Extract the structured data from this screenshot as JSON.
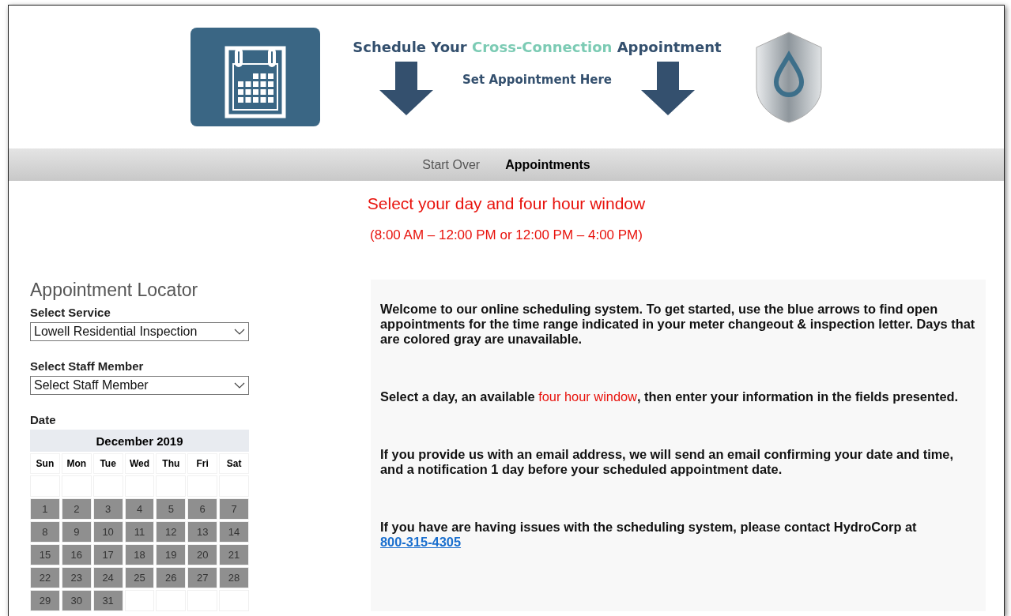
{
  "header": {
    "title": [
      {
        "kind": "plain",
        "text": "Schedule Your "
      },
      {
        "kind": "accent",
        "text": "Cross-Connection"
      },
      {
        "kind": "plain",
        "text": " Appointment"
      }
    ],
    "subtitle": "Set Appointment Here"
  },
  "nav": [
    {
      "label": "Start Over",
      "selected": false
    },
    {
      "label": "Appointments",
      "selected": true
    }
  ],
  "instructions": {
    "heading": "Select your day and four hour window",
    "hours": "(8:00 AM – 12:00 PM or 12:00 PM – 4:00 PM)"
  },
  "locator": {
    "title": "Appointment Locator",
    "service_label": "Select Service",
    "service_value": "Lowell Residential Inspection",
    "staff_label": "Select Staff Member",
    "staff_value": "Select Staff Member",
    "date_label": "Date"
  },
  "calendar": {
    "month": "December 2019",
    "weekdays": [
      "Sun",
      "Mon",
      "Tue",
      "Wed",
      "Thu",
      "Fri",
      "Sat"
    ],
    "weeks": [
      [
        {
          "kind": "blank"
        },
        {
          "kind": "blank"
        },
        {
          "kind": "blank"
        },
        {
          "kind": "blank"
        },
        {
          "kind": "blank"
        },
        {
          "kind": "blank"
        },
        {
          "kind": "blank"
        }
      ],
      [
        {
          "kind": "day",
          "label": "1",
          "disabled": true
        },
        {
          "kind": "day",
          "label": "2",
          "disabled": true
        },
        {
          "kind": "day",
          "label": "3",
          "disabled": true
        },
        {
          "kind": "day",
          "label": "4",
          "disabled": true
        },
        {
          "kind": "day",
          "label": "5",
          "disabled": true
        },
        {
          "kind": "day",
          "label": "6",
          "disabled": true
        },
        {
          "kind": "day",
          "label": "7",
          "disabled": true
        }
      ],
      [
        {
          "kind": "day",
          "label": "8",
          "disabled": true
        },
        {
          "kind": "day",
          "label": "9",
          "disabled": true
        },
        {
          "kind": "day",
          "label": "10",
          "disabled": true
        },
        {
          "kind": "day",
          "label": "11",
          "disabled": true
        },
        {
          "kind": "day",
          "label": "12",
          "disabled": true
        },
        {
          "kind": "day",
          "label": "13",
          "disabled": true
        },
        {
          "kind": "day",
          "label": "14",
          "disabled": true
        }
      ],
      [
        {
          "kind": "day",
          "label": "15",
          "disabled": true
        },
        {
          "kind": "day",
          "label": "16",
          "disabled": true
        },
        {
          "kind": "day",
          "label": "17",
          "disabled": true
        },
        {
          "kind": "day",
          "label": "18",
          "disabled": true
        },
        {
          "kind": "day",
          "label": "19",
          "disabled": true
        },
        {
          "kind": "day",
          "label": "20",
          "disabled": true
        },
        {
          "kind": "day",
          "label": "21",
          "disabled": true
        }
      ],
      [
        {
          "kind": "day",
          "label": "22",
          "disabled": true
        },
        {
          "kind": "day",
          "label": "23",
          "disabled": true
        },
        {
          "kind": "day",
          "label": "24",
          "disabled": true
        },
        {
          "kind": "day",
          "label": "25",
          "disabled": true
        },
        {
          "kind": "day",
          "label": "26",
          "disabled": true
        },
        {
          "kind": "day",
          "label": "27",
          "disabled": true
        },
        {
          "kind": "day",
          "label": "28",
          "disabled": true
        }
      ],
      [
        {
          "kind": "day",
          "label": "29",
          "disabled": true
        },
        {
          "kind": "day",
          "label": "30",
          "disabled": true
        },
        {
          "kind": "day",
          "label": "31",
          "disabled": true
        },
        {
          "kind": "blank"
        },
        {
          "kind": "blank"
        },
        {
          "kind": "blank"
        },
        {
          "kind": "blank"
        }
      ]
    ]
  },
  "info": [
    [
      {
        "kind": "plain",
        "text": "Welcome to our online scheduling system.  To get started, use the blue arrows to find open appointments for the time range indicated in your meter changeout & inspection letter.  Days that are colored gray are unavailable."
      }
    ],
    [
      {
        "kind": "plain",
        "text": "Select a day, an available "
      },
      {
        "kind": "highlight",
        "text": "four hour window"
      },
      {
        "kind": "plain",
        "text": ", then enter your information in the fields presented."
      }
    ],
    [
      {
        "kind": "plain",
        "text": "If you provide us with an email address, we will send an email confirming your date and time, and a notification 1 day before your scheduled appointment date."
      }
    ],
    [
      {
        "kind": "plain",
        "text": "If you have are having issues with the scheduling system, please contact HydroCorp at "
      },
      {
        "kind": "link",
        "text": "800-315-4305"
      }
    ]
  ]
}
